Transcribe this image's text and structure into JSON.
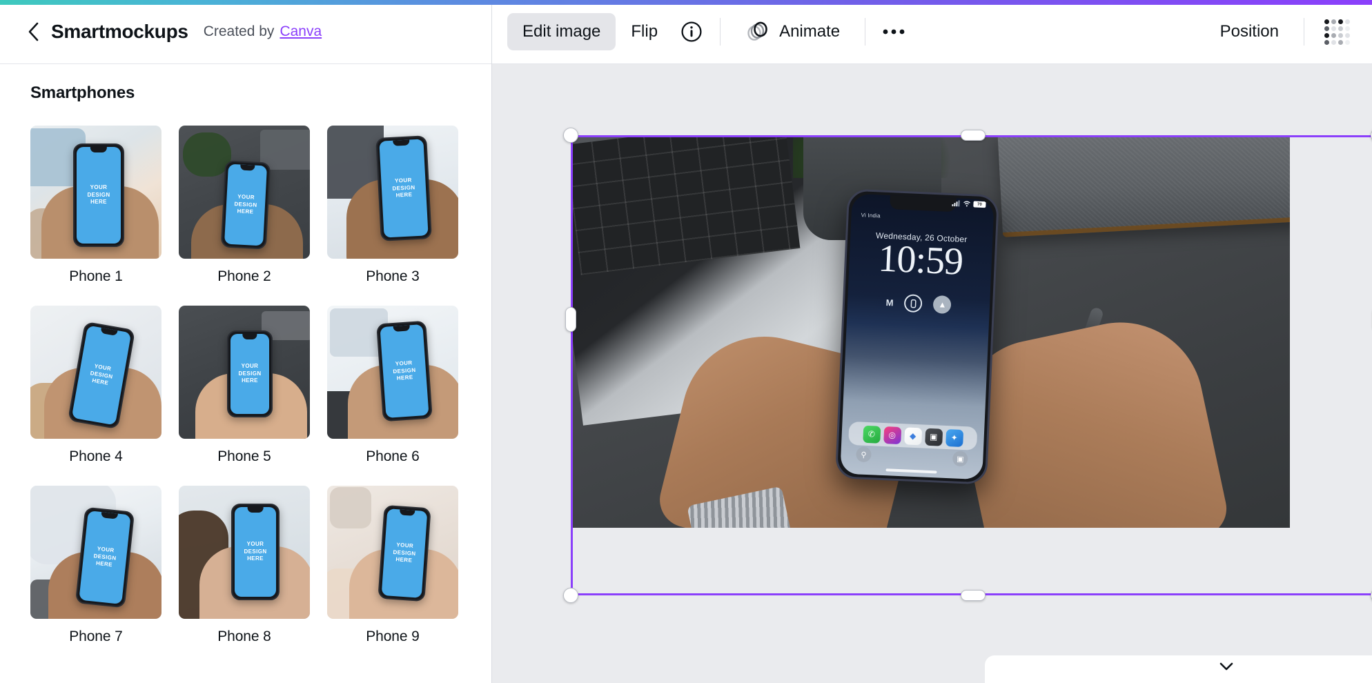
{
  "accent": {
    "start": "#3ec9bd",
    "mid": "#5b8ee0",
    "end": "#8b3ffb"
  },
  "left_panel": {
    "back_icon": "chevron-left-icon",
    "title": "Smartmockups",
    "created_by_text": "Created by",
    "created_by_link": "Canva",
    "section_heading": "Smartphones",
    "thumb_caption": "YOUR\nDESIGN\nHERE",
    "thumb_caption_lines": [
      "YOUR",
      "DESIGN",
      "HERE"
    ],
    "items": [
      {
        "label": "Phone 1",
        "scene": "s1"
      },
      {
        "label": "Phone 2",
        "scene": "s2"
      },
      {
        "label": "Phone 3",
        "scene": "s3"
      },
      {
        "label": "Phone 4",
        "scene": "s4"
      },
      {
        "label": "Phone 5",
        "scene": "s5"
      },
      {
        "label": "Phone 6",
        "scene": "s6"
      },
      {
        "label": "Phone 7",
        "scene": "s7"
      },
      {
        "label": "Phone 8",
        "scene": "s8"
      },
      {
        "label": "Phone 9",
        "scene": "s9"
      }
    ]
  },
  "toolbar": {
    "edit_image_label": "Edit image",
    "flip_label": "Flip",
    "info_icon": "info-circle-icon",
    "animate_label": "Animate",
    "animate_icon": "layered-circles-icon",
    "more_icon": "ellipsis-icon",
    "position_label": "Position",
    "transparency_icon": "transparency-dot-grid-icon",
    "active_tool": "Edit image"
  },
  "canvas": {
    "rotate_icon": "rotate-icon",
    "comment_icon": "add-comment-icon",
    "collapse_icon": "chevron-down-icon",
    "selection_color": "#8b3ffb"
  },
  "mockup_phone": {
    "carrier": "Vi India",
    "battery": "70",
    "date": "Wednesday, 26 October",
    "time": "10:59",
    "widget_left": "M",
    "widget_center": "flashlight-icon",
    "widget_right": "navigation-icon",
    "dock_apps": [
      {
        "name": "whatsapp-icon",
        "glyph": "✆",
        "color1": "#4cd964",
        "color2": "#25a93f"
      },
      {
        "name": "instagram-icon",
        "glyph": "◎",
        "color1": "#f9407b",
        "color2": "#7b34d6"
      },
      {
        "name": "google-maps-icon",
        "glyph": "◆",
        "color1": "#ffffff",
        "color2": "#eceff1"
      },
      {
        "name": "camera-icon",
        "glyph": "▣",
        "color1": "#4a4d52",
        "color2": "#2b2e33"
      },
      {
        "name": "safari-icon",
        "glyph": "✦",
        "color1": "#4aa8f0",
        "color2": "#1b6fd0"
      }
    ],
    "corner_left": "flashlight-icon",
    "corner_right": "camera-icon"
  }
}
